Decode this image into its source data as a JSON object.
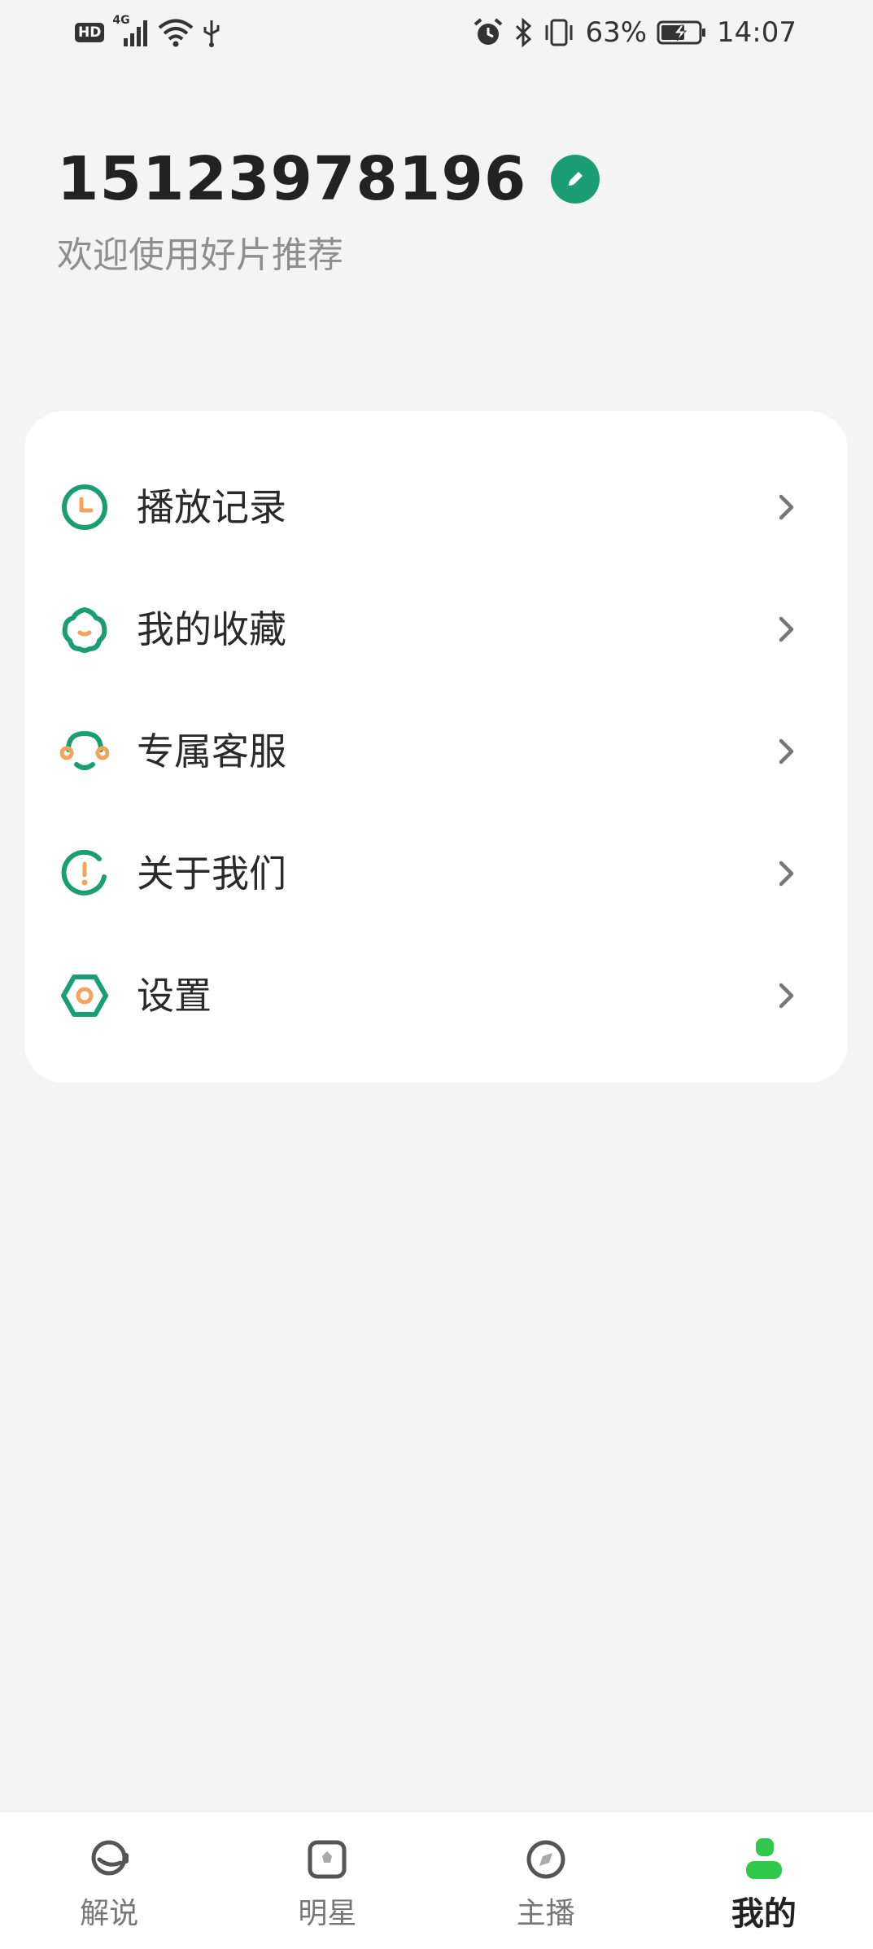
{
  "status_bar": {
    "hd": "HD",
    "network": "4G",
    "battery": "63%",
    "time": "14:07"
  },
  "profile": {
    "phone": "15123978196",
    "welcome": "欢迎使用好片推荐"
  },
  "menu": [
    {
      "label": "播放记录",
      "icon": "clock-icon"
    },
    {
      "label": "我的收藏",
      "icon": "flower-icon"
    },
    {
      "label": "专属客服",
      "icon": "headset-icon"
    },
    {
      "label": "关于我们",
      "icon": "info-icon"
    },
    {
      "label": "设置",
      "icon": "settings-hexagon-icon"
    }
  ],
  "nav": {
    "active_index": 3,
    "items": [
      {
        "label": "解说",
        "icon": "commentary-icon"
      },
      {
        "label": "明星",
        "icon": "star-card-icon"
      },
      {
        "label": "主播",
        "icon": "compass-icon"
      },
      {
        "label": "我的",
        "icon": "user-icon"
      }
    ]
  },
  "colors": {
    "brand_green": "#1c9e74",
    "accent_orange": "#f3a35a",
    "nav_active": "#2fc84a"
  }
}
